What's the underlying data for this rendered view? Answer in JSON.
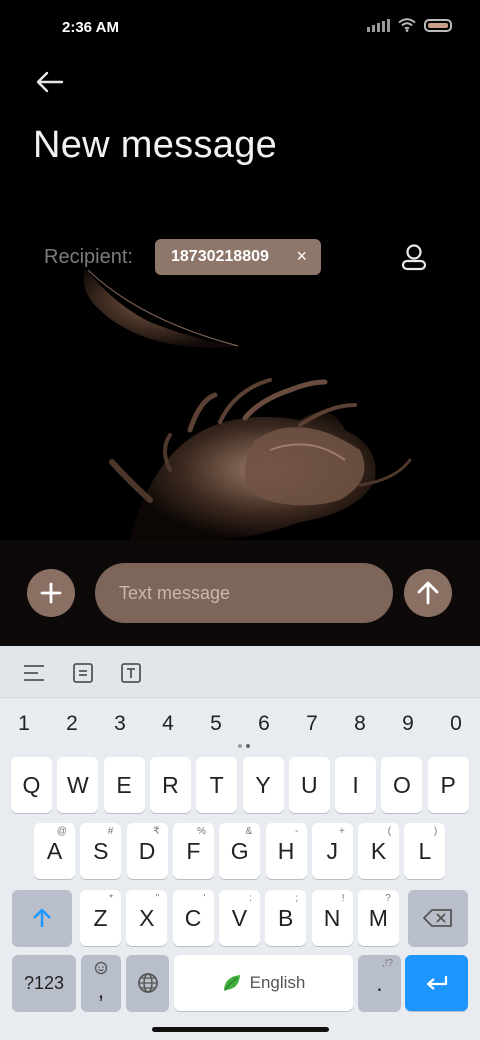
{
  "status_bar": {
    "time": "2:36 AM"
  },
  "header": {
    "title": "New message"
  },
  "recipient": {
    "label": "Recipient:",
    "chip_number": "18730218809",
    "chip_remove": "×"
  },
  "composer": {
    "placeholder": "Text message"
  },
  "keyboard": {
    "numbers": [
      "1",
      "2",
      "3",
      "4",
      "5",
      "6",
      "7",
      "8",
      "9",
      "0"
    ],
    "row1": [
      {
        "k": "Q"
      },
      {
        "k": "W"
      },
      {
        "k": "E"
      },
      {
        "k": "R"
      },
      {
        "k": "T"
      },
      {
        "k": "Y"
      },
      {
        "k": "U"
      },
      {
        "k": "I"
      },
      {
        "k": "O"
      },
      {
        "k": "P"
      }
    ],
    "row2": [
      {
        "k": "A",
        "h": "@"
      },
      {
        "k": "S",
        "h": "#"
      },
      {
        "k": "D",
        "h": "₹"
      },
      {
        "k": "F",
        "h": "%"
      },
      {
        "k": "G",
        "h": "&"
      },
      {
        "k": "H",
        "h": "-"
      },
      {
        "k": "J",
        "h": "+"
      },
      {
        "k": "K",
        "h": "("
      },
      {
        "k": "L",
        "h": ")"
      }
    ],
    "row3": [
      {
        "k": "Z",
        "h": "*"
      },
      {
        "k": "X",
        "h": "\""
      },
      {
        "k": "C",
        "h": "'"
      },
      {
        "k": "V",
        "h": ":"
      },
      {
        "k": "B",
        "h": ";"
      },
      {
        "k": "N",
        "h": "!"
      },
      {
        "k": "M",
        "h": "?"
      }
    ],
    "symbols_label": "?123",
    "comma_label": ",",
    "space_label": "English",
    "period_label": ".",
    "period_hint": ",!?"
  },
  "colors": {
    "accent": "#8a6f63",
    "keyboard_enter": "#1e96ff",
    "chip": "#8e766a"
  }
}
